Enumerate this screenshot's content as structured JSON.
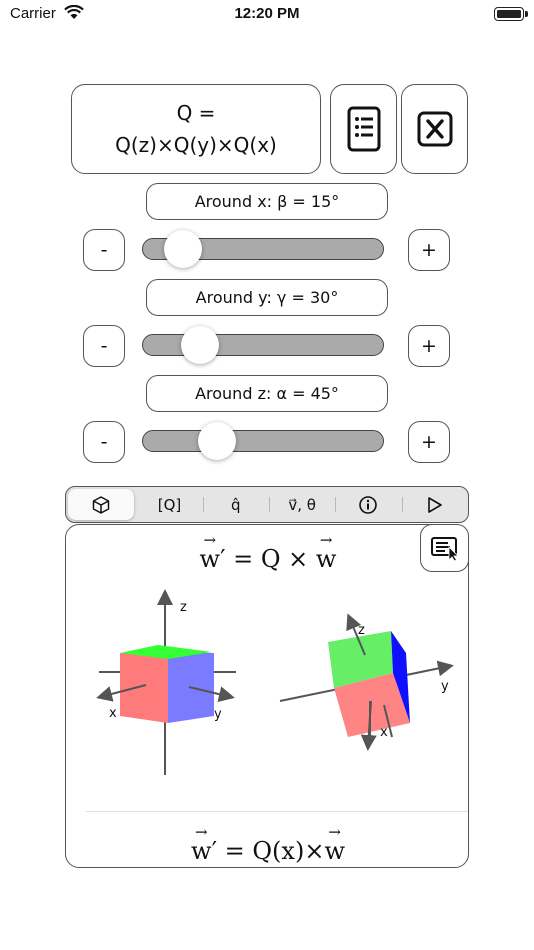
{
  "status_bar": {
    "carrier": "Carrier",
    "time": "12:20 PM"
  },
  "formula": {
    "line1": "Q =",
    "line2": "Q(z)×Q(y)×Q(x)"
  },
  "controls": [
    {
      "label": "Around x: β = 15°",
      "minus": "-",
      "plus": "+",
      "value_deg": 15
    },
    {
      "label": "Around y: γ = 30°",
      "minus": "-",
      "plus": "+",
      "value_deg": 30
    },
    {
      "label": "Around z: α = 45°",
      "minus": "-",
      "plus": "+",
      "value_deg": 45
    }
  ],
  "toolbar": {
    "items": [
      {
        "icon": "cube-icon"
      },
      {
        "label": "[Q]"
      },
      {
        "label": "q̂"
      },
      {
        "label": "v⃗, θ"
      },
      {
        "icon": "info-icon"
      },
      {
        "icon": "play-icon"
      }
    ],
    "active_index": 0
  },
  "panel": {
    "top_equation": {
      "w": "w",
      "rhs": "′ = Q × ",
      "w2": "w"
    },
    "bottom_equation": {
      "w": "w",
      "rhs": "′ = Q(x)×",
      "w2": "w"
    },
    "axes": {
      "x": "x",
      "y": "y",
      "z": "z"
    }
  },
  "colors": {
    "red_face": "#ff7b7b",
    "green_face": "#33ff33",
    "blue_face": "#7b7bff",
    "deep_blue": "#1010ff"
  }
}
